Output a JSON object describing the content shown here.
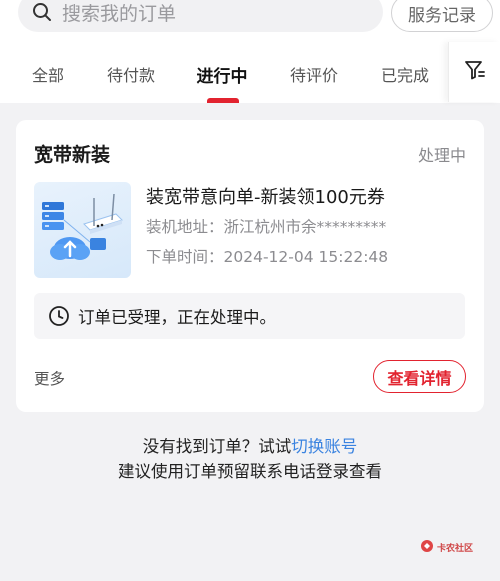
{
  "search": {
    "placeholder": "搜索我的订单",
    "service_records": "服务记录"
  },
  "tabs": [
    {
      "label": "全部"
    },
    {
      "label": "待付款"
    },
    {
      "label": "进行中"
    },
    {
      "label": "待评价"
    },
    {
      "label": "已完成"
    }
  ],
  "active_tab": "进行中",
  "order": {
    "category": "宽带新装",
    "status": "处理中",
    "product_name": "装宽带意向单-新装领100元券",
    "address_label": "装机地址：",
    "address_value": "浙江杭州市余*********",
    "time_label": "下单时间：",
    "time_value": "2024-12-04 15:22:48",
    "notice": "订单已受理，正在处理中。",
    "more_label": "更多",
    "detail_button": "查看详情"
  },
  "footer": {
    "prefix": "没有找到订单？试试",
    "link": "切换账号",
    "line2": "建议使用订单预留联系电话登录查看"
  },
  "watermark": {
    "text": "卡农社区"
  },
  "colors": {
    "accent": "#e2232f",
    "link": "#3a83e0",
    "background": "#f2f2f4"
  }
}
